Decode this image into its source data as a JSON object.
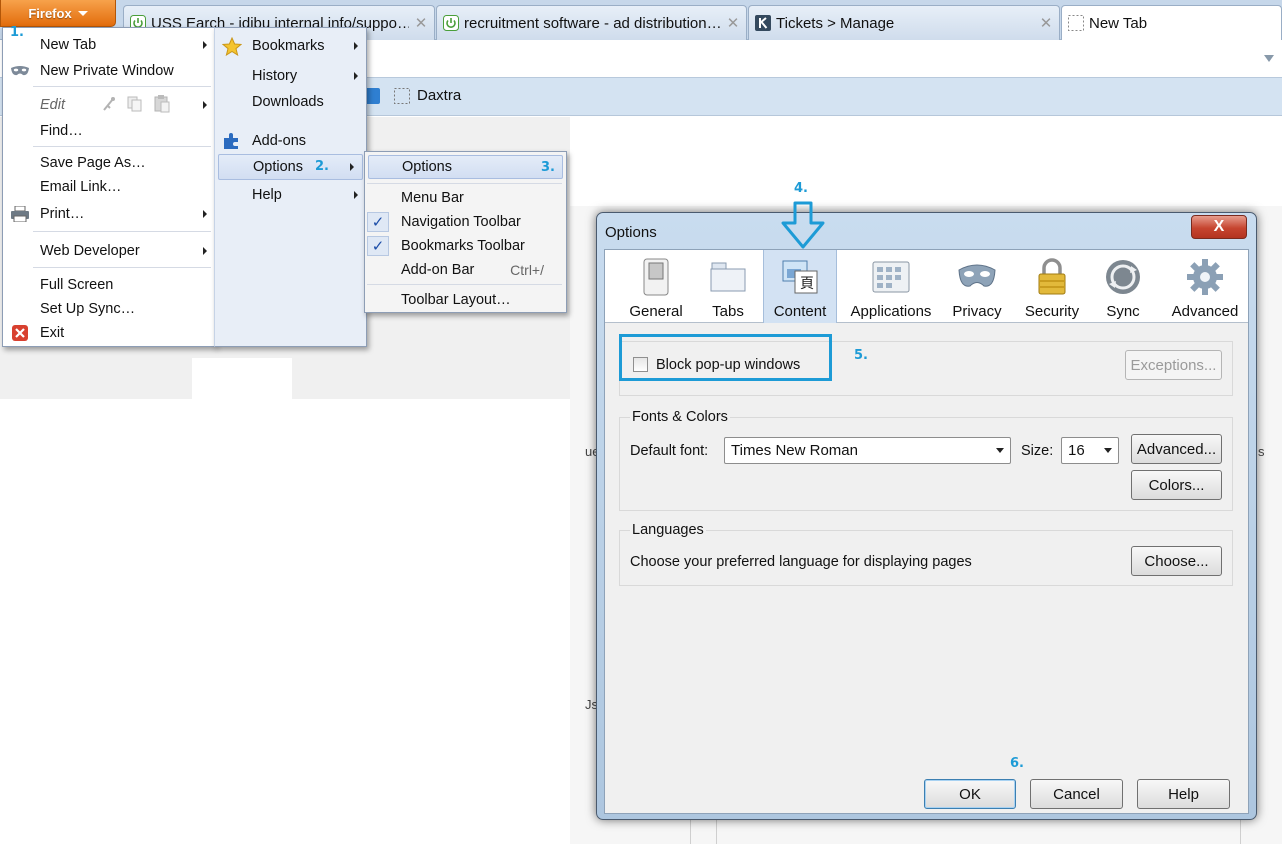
{
  "firefox_button": {
    "label": "Firefox"
  },
  "tabs": [
    {
      "title": "USS Earch - idibu internal info/suppo…",
      "icon": "power-icon"
    },
    {
      "title": "recruitment software - ad distribution…",
      "icon": "power-icon"
    },
    {
      "title": "Tickets > Manage",
      "icon": "k-icon"
    },
    {
      "title": "New Tab",
      "icon": "dotted-page-icon"
    }
  ],
  "bookmarks_bar": {
    "item": "Daxtra"
  },
  "page_fragments": {
    "a": "ue",
    "b": "Js",
    "c": "s"
  },
  "firefox_menu": {
    "left": [
      "New Tab",
      "New Private Window",
      "Edit",
      "Find…",
      "Save Page As…",
      "Email Link…",
      "Print…",
      "Web Developer",
      "Full Screen",
      "Set Up Sync…",
      "Exit"
    ],
    "right": [
      "Bookmarks",
      "History",
      "Downloads",
      "Add-ons",
      "Options",
      "Help"
    ]
  },
  "options_submenu": {
    "items": [
      "Options",
      "Menu Bar",
      "Navigation Toolbar",
      "Bookmarks Toolbar",
      "Add-on Bar",
      "Toolbar Layout…"
    ],
    "addon_shortcut": "Ctrl+/",
    "checked": [
      "Navigation Toolbar",
      "Bookmarks Toolbar"
    ]
  },
  "steps": [
    "1.",
    "2.",
    "3.",
    "4.",
    "5.",
    "6."
  ],
  "dialog": {
    "title": "Options",
    "close_glyph": "X",
    "panes": [
      "General",
      "Tabs",
      "Content",
      "Applications",
      "Privacy",
      "Security",
      "Sync",
      "Advanced"
    ],
    "selected_pane": "Content",
    "block_popups": {
      "label": "Block pop-up windows",
      "checked": false
    },
    "exceptions_button": "Exceptions...",
    "fonts_colors": {
      "title": "Fonts & Colors",
      "default_font_label": "Default font:",
      "default_font": "Times New Roman",
      "size_label": "Size:",
      "size": "16",
      "advanced_button": "Advanced...",
      "colors_button": "Colors..."
    },
    "languages": {
      "title": "Languages",
      "text": "Choose your preferred language for displaying pages",
      "choose_button": "Choose..."
    },
    "ok": "OK",
    "cancel": "Cancel",
    "help": "Help"
  },
  "colors": {
    "accent": "#1d9bd6",
    "firefox_orange": "#e26c0c",
    "close_red": "#c64530"
  }
}
